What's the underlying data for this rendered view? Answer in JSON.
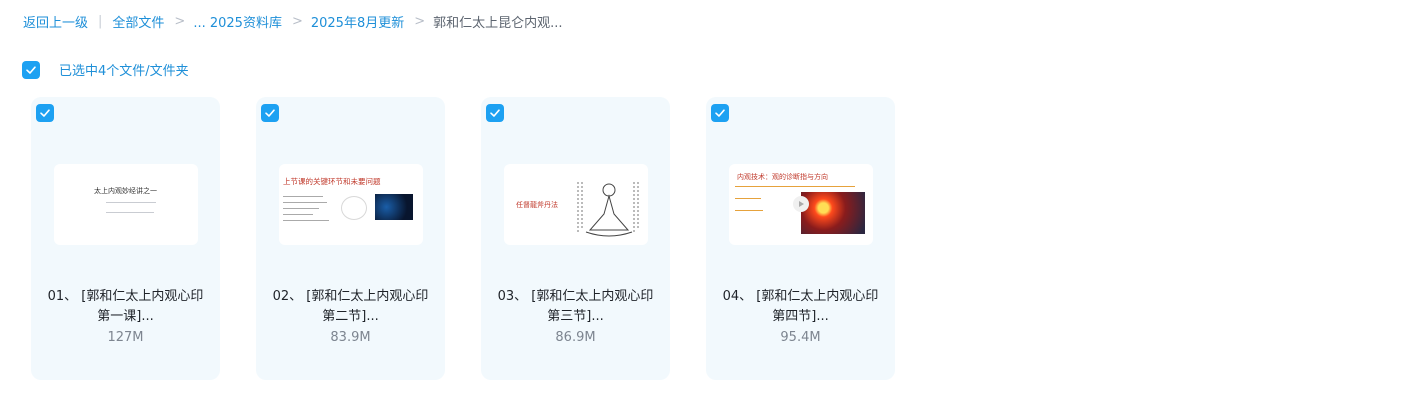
{
  "breadcrumb": {
    "back": "返回上一级",
    "all_files": "全部文件",
    "ellipsis_crumb": "... 2025资料库",
    "month": "2025年8月更新",
    "current": "郭和仁太上昆仑内观..."
  },
  "selection": {
    "label": "已选中4个文件/文件夹"
  },
  "files": [
    {
      "name_line1": "01、 [郭和仁太上内观心印",
      "name_line2": "第一课]...",
      "size": "127M",
      "thumb_title": "太上内观妙经讲之一"
    },
    {
      "name_line1": "02、 [郭和仁太上内观心印",
      "name_line2": "第二节]...",
      "size": "83.9M",
      "thumb_title": "上节课的关键环节和未要问题"
    },
    {
      "name_line1": "03、 [郭和仁太上内观心印",
      "name_line2": "第三节]...",
      "size": "86.9M",
      "thumb_title": "任督龍斧丹法"
    },
    {
      "name_line1": "04、 [郭和仁太上内观心印",
      "name_line2": "第四节]...",
      "size": "95.4M",
      "thumb_title": "内观技术：观的诊断指与方向"
    }
  ],
  "colors": {
    "accent": "#1da1f2",
    "link": "#1e8fd8",
    "card_bg": "#f2f9fd"
  },
  "icons": {
    "check": "check-icon",
    "video_play": "play-icon"
  }
}
